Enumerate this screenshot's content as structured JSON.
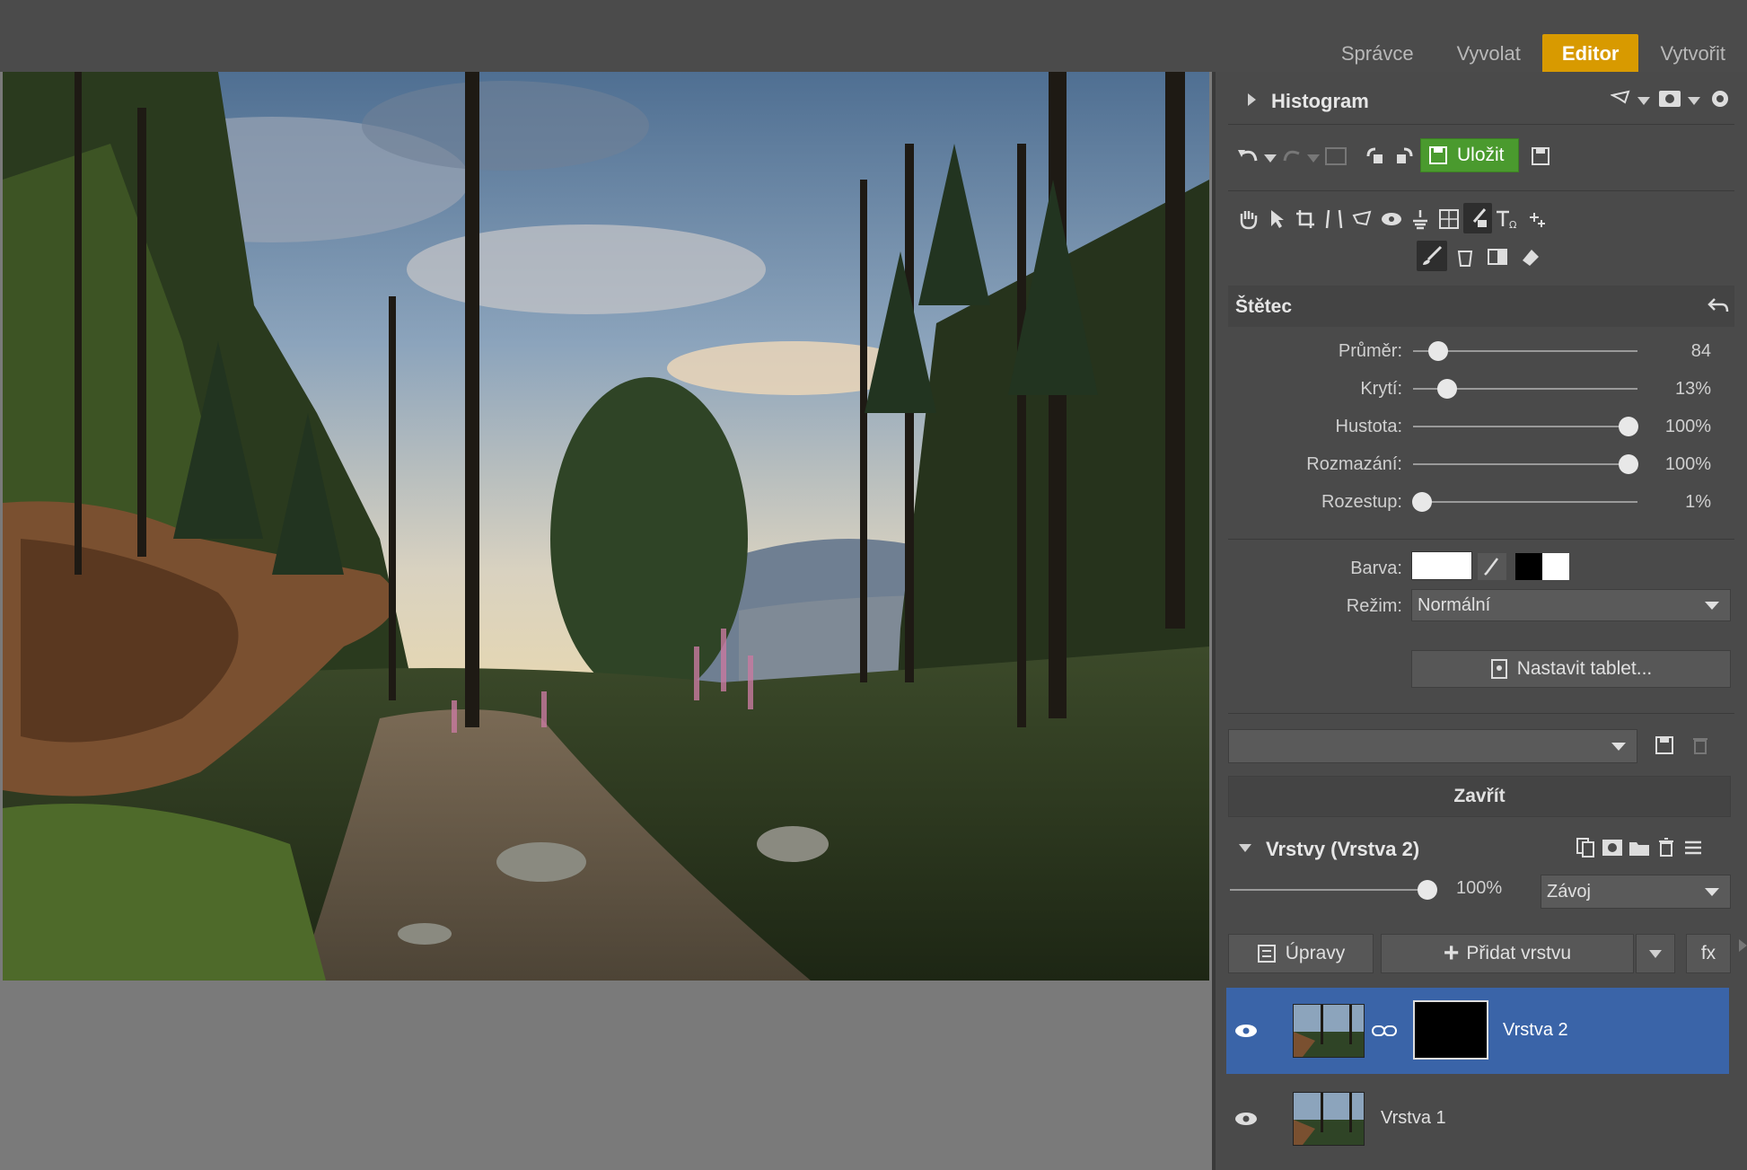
{
  "modes": [
    {
      "label": "Správce",
      "active": false
    },
    {
      "label": "Vyvolat",
      "active": false
    },
    {
      "label": "Editor",
      "active": true
    },
    {
      "label": "Vytvořit",
      "active": false
    }
  ],
  "histogram": {
    "title": "Histogram"
  },
  "toolbar": {
    "save_label": "Uložit"
  },
  "brush": {
    "title": "Štětec",
    "sliders": [
      {
        "label": "Průměr:",
        "value": "84",
        "fraction": 0.11
      },
      {
        "label": "Krytí:",
        "value": "13%",
        "fraction": 0.15
      },
      {
        "label": "Hustota:",
        "value": "100%",
        "fraction": 0.96
      },
      {
        "label": "Rozmazání:",
        "value": "100%",
        "fraction": 0.96
      },
      {
        "label": "Rozestup:",
        "value": "1%",
        "fraction": 0.04
      }
    ],
    "color_label": "Barva:",
    "color_value": "#ffffff",
    "mode_label": "Režim:",
    "mode_value": "Normální",
    "tablet_button": "Nastavit tablet..."
  },
  "preset": {
    "value": ""
  },
  "close_button": "Zavřít",
  "layers": {
    "title": "Vrstvy (Vrstva 2)",
    "opacity": "100%",
    "opacity_fraction": 1.0,
    "blend_mode": "Závoj",
    "adjust_button": "Úpravy",
    "add_layer_button": "Přidat vrstvu",
    "fx_button": "fx",
    "items": [
      {
        "name": "Vrstva 2",
        "selected": true,
        "has_mask": true
      },
      {
        "name": "Vrstva 1",
        "selected": false,
        "has_mask": false
      }
    ]
  },
  "colors": {
    "accent": "#d89a00",
    "save_green": "#4a9a2e",
    "layer_selected": "#3a64a8"
  }
}
